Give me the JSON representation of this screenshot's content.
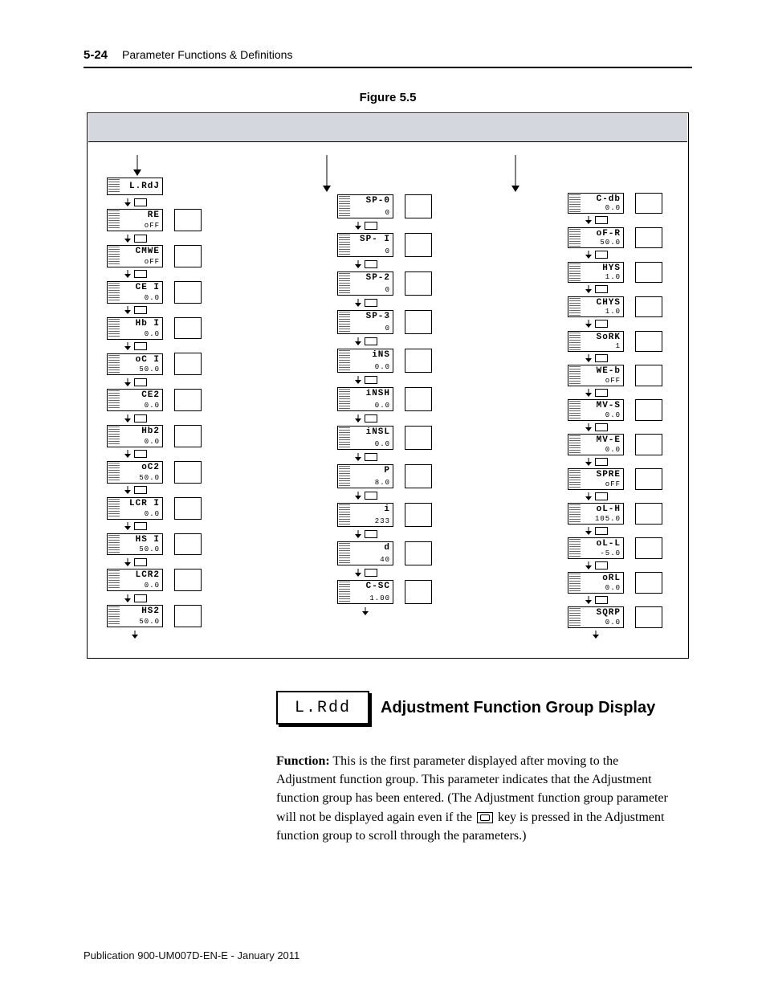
{
  "header": {
    "page_number": "5-24",
    "section": "Parameter Functions & Definitions"
  },
  "figure": {
    "caption": "Figure 5.5",
    "columns": [
      {
        "id": "A",
        "head": {
          "line1": "L.RdJ"
        },
        "items": [
          {
            "line1": "RE",
            "line2": "oFF"
          },
          {
            "line1": "CMWE",
            "line2": "oFF"
          },
          {
            "line1": "CE I",
            "line2": "0.0"
          },
          {
            "line1": "Hb I",
            "line2": "0.0"
          },
          {
            "line1": "oC I",
            "line2": "50.0"
          },
          {
            "line1": "CE2",
            "line2": "0.0"
          },
          {
            "line1": "Hb2",
            "line2": "0.0"
          },
          {
            "line1": "oC2",
            "line2": "50.0"
          },
          {
            "line1": "LCR I",
            "line2": "0.0"
          },
          {
            "line1": "HS I",
            "line2": "50.0"
          },
          {
            "line1": "LCR2",
            "line2": "0.0"
          },
          {
            "line1": "HS2",
            "line2": "50.0"
          }
        ]
      },
      {
        "id": "B",
        "items": [
          {
            "line1": "SP-0",
            "line2": "0"
          },
          {
            "line1": "SP- I",
            "line2": "0"
          },
          {
            "line1": "SP-2",
            "line2": "0"
          },
          {
            "line1": "SP-3",
            "line2": "0"
          },
          {
            "line1": "iNS",
            "line2": "0.0"
          },
          {
            "line1": "iNSH",
            "line2": "0.0"
          },
          {
            "line1": "iNSL",
            "line2": "0.0"
          },
          {
            "line1": "P",
            "line2": "8.0"
          },
          {
            "line1": "i",
            "line2": "233"
          },
          {
            "line1": "d",
            "line2": "40"
          },
          {
            "line1": "C-SC",
            "line2": "1.00"
          }
        ]
      },
      {
        "id": "C",
        "items": [
          {
            "line1": "C-db",
            "line2": "0.0"
          },
          {
            "line1": "oF-R",
            "line2": "50.0"
          },
          {
            "line1": "HYS",
            "line2": "1.0"
          },
          {
            "line1": "CHYS",
            "line2": "1.0"
          },
          {
            "line1": "SoRK",
            "line2": "1"
          },
          {
            "line1": "WE-b",
            "line2": "oFF"
          },
          {
            "line1": "MV-S",
            "line2": "0.0"
          },
          {
            "line1": "MV-E",
            "line2": "0.0"
          },
          {
            "line1": "SPRE",
            "line2": "oFF"
          },
          {
            "line1": "oL-H",
            "line2": "105.0"
          },
          {
            "line1": "oL-L",
            "line2": "-5.0"
          },
          {
            "line1": "oRL",
            "line2": "0.0"
          },
          {
            "line1": "SQRP",
            "line2": "0.0"
          }
        ]
      }
    ]
  },
  "group": {
    "display_code": "L.Rdd",
    "title": "Adjustment Function Group Display",
    "body_lead": "Function:",
    "body": " This is the first parameter displayed after moving to the Adjustment function group. This parameter indicates that the Adjustment function group has been entered. (The Adjustment function group parameter will not be displayed again even if the ",
    "body_tail": " key is pressed in the Adjustment function group to scroll through the parameters.)"
  },
  "footer": {
    "pub": "Publication 900-UM007D-EN-E - January 2011"
  }
}
